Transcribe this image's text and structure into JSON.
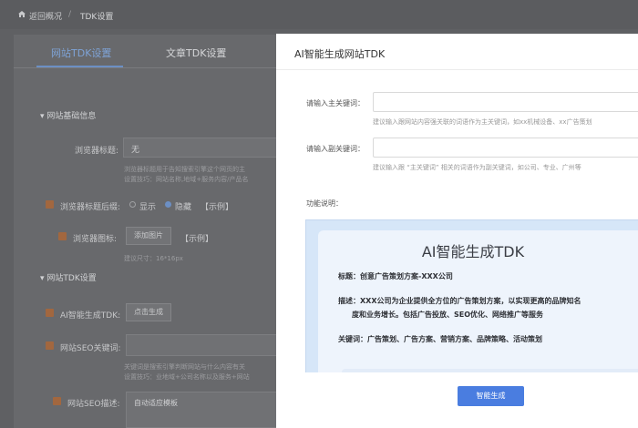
{
  "breadcrumb": {
    "back_label": "返回概况",
    "separator": "/",
    "current": "TDK设置"
  },
  "tabs": [
    {
      "label": "网站TDK设置"
    },
    {
      "label": "文章TDK设置"
    }
  ],
  "background_form": {
    "section1": "网站基础信息",
    "browser_title_label": "浏览器标题:",
    "browser_title_value": "无",
    "browser_title_hint1": "浏览器标题用于告知搜索引擎这个网页的主",
    "browser_title_hint2": "设置技巧：网站名称,地域+服务内容/产品名",
    "title_suffix_label": "浏览器标题后缀:",
    "suffix_show": "显示",
    "suffix_hide": "隐藏",
    "suffix_example": "【示例】",
    "favicon_label": "浏览器图标:",
    "upload_button": "添加图片",
    "favicon_example": "【示例】",
    "favicon_size": "建议尺寸：16*16px",
    "section2": "网站TDK设置",
    "ai_label": "AI智能生成TDK:",
    "ai_button": "点击生成",
    "seo_keywords_label": "网站SEO关键词:",
    "seo_hint1": "关键词是搜索引擎判断网站与什么内容有关",
    "seo_hint2": "设置技巧：业地域+公司名称以及服务+网站",
    "seo_desc_label": "网站SEO描述:",
    "seo_desc_button": "自动适应模板"
  },
  "modal": {
    "title": "AI智能生成网站TDK",
    "main_keyword_label": "请输入主关键词：",
    "main_keyword_value": "",
    "main_keyword_hint": "建议输入跟网站内容强关联的词语作为主关键词，如xx机械设备、xx广告策划",
    "sub_keyword_label": "请输入副关键词：",
    "sub_keyword_value": "",
    "sub_keyword_hint": "建议输入跟 “主关键词” 相关的词语作为副关键词，如公司、专业、广州等",
    "function_label": "功能说明：",
    "preview": {
      "title": "AI智能生成TDK",
      "title_row": "标题：创意广告策划方案-XXX公司",
      "desc_row_1": "描述：XXX公司为企业提供全方位的广告策划方案，以实现更高的品牌知名",
      "desc_row_2": "度和业务增长。包括广告投放、SEO优化、网络推广等服务",
      "keywords_row": "关键词：广告策划、广告方案、营销方案、品牌策略、活动策划"
    },
    "generate_button": "智能生成"
  },
  "colors": {
    "primary": "#4a7de0",
    "overlay": "#5f6063",
    "preview_bg": "#d6e6f8"
  }
}
